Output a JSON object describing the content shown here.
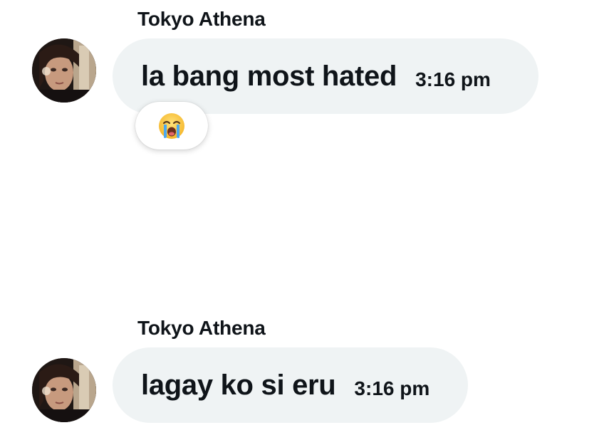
{
  "messages": [
    {
      "sender": "Tokyo Athena",
      "text": "la bang most hated",
      "time": "3:16 pm",
      "reaction": "loudly-crying-face-emoji"
    },
    {
      "sender": "Tokyo Athena",
      "text": "lagay ko si eru",
      "time": "3:16 pm"
    }
  ],
  "colors": {
    "bubble_background": "#eff3f4",
    "text": "#0f1419",
    "page_background": "#ffffff"
  }
}
